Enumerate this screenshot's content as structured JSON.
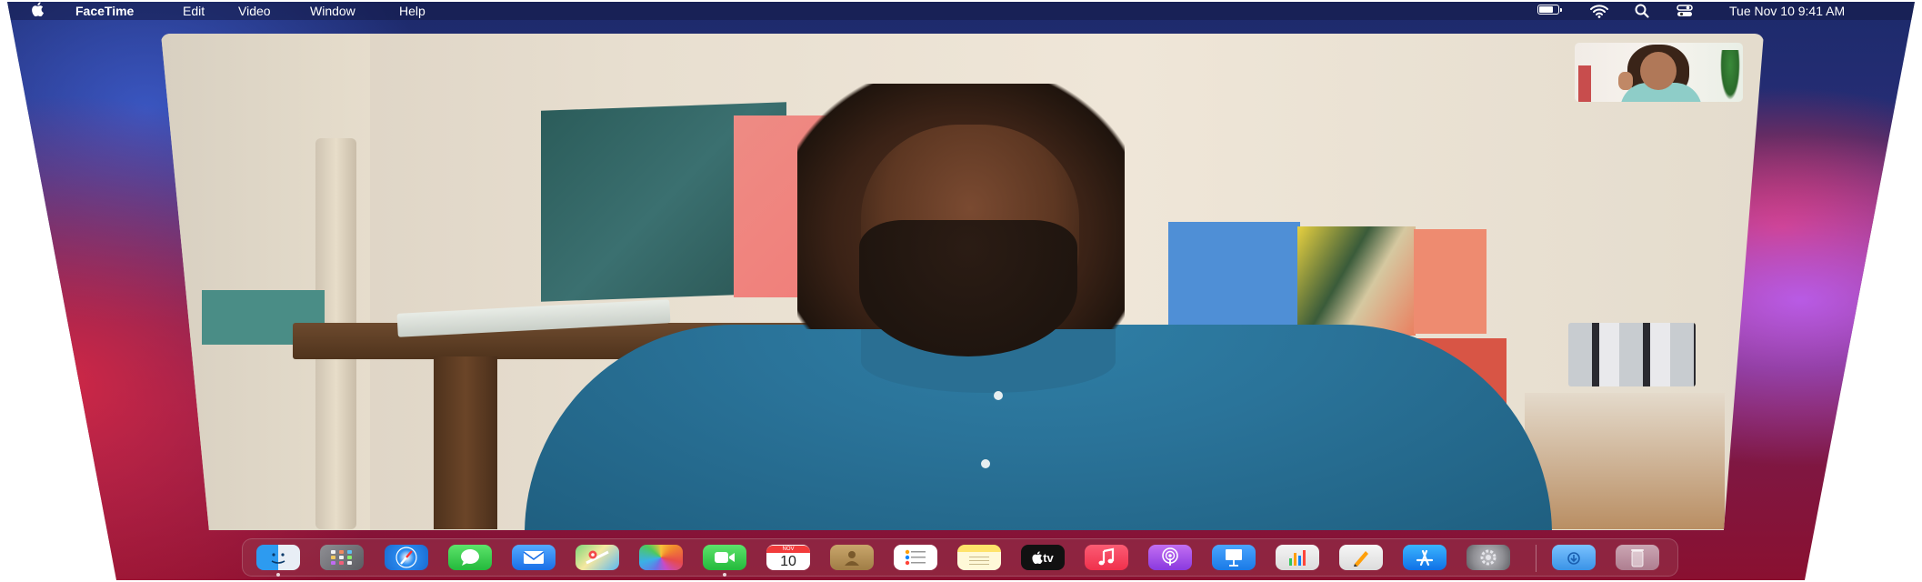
{
  "menubar": {
    "apple_icon": "apple-icon",
    "app_name": "FaceTime",
    "menus": [
      "Edit",
      "Video",
      "Window",
      "Help"
    ],
    "status_icons": [
      "battery-icon",
      "wifi-icon",
      "search-icon",
      "control-center-icon"
    ],
    "battery_level": 0.8,
    "clock": "Tue Nov 10   9:41 AM"
  },
  "dock": {
    "items": [
      {
        "name": "Finder",
        "icon": "finder-icon",
        "running": true
      },
      {
        "name": "Launchpad",
        "icon": "launchpad-icon",
        "running": false
      },
      {
        "name": "Safari",
        "icon": "safari-icon",
        "running": false
      },
      {
        "name": "Messages",
        "icon": "messages-icon",
        "running": false
      },
      {
        "name": "Mail",
        "icon": "mail-icon",
        "running": false
      },
      {
        "name": "Maps",
        "icon": "maps-icon",
        "running": false
      },
      {
        "name": "Photos",
        "icon": "photos-icon",
        "running": false
      },
      {
        "name": "FaceTime",
        "icon": "facetime-icon",
        "running": true
      },
      {
        "name": "Calendar",
        "icon": "calendar-icon",
        "running": false
      },
      {
        "name": "Contacts",
        "icon": "contacts-icon",
        "running": false
      },
      {
        "name": "Reminders",
        "icon": "reminders-icon",
        "running": false
      },
      {
        "name": "Notes",
        "icon": "notes-icon",
        "running": false
      },
      {
        "name": "TV",
        "icon": "tv-icon",
        "running": false
      },
      {
        "name": "Music",
        "icon": "music-icon",
        "running": false
      },
      {
        "name": "Podcasts",
        "icon": "podcasts-icon",
        "running": false
      },
      {
        "name": "Keynote",
        "icon": "keynote-icon",
        "running": false
      },
      {
        "name": "Numbers",
        "icon": "numbers-icon",
        "running": false
      },
      {
        "name": "Pages",
        "icon": "pages-icon",
        "running": false
      },
      {
        "name": "App Store",
        "icon": "app-store-icon",
        "running": false
      },
      {
        "name": "System Preferences",
        "icon": "system-preferences-icon",
        "running": false
      },
      {
        "name": "Downloads",
        "icon": "downloads-folder-icon",
        "running": false
      },
      {
        "name": "Trash",
        "icon": "trash-icon",
        "running": false
      }
    ],
    "calendar_month": "NOV",
    "calendar_day": "10",
    "tv_label": "tv"
  },
  "colors": {
    "accent_red": "#c8102e",
    "accent_blue": "#1c2a6b",
    "facetime_green": "#24b93c"
  }
}
